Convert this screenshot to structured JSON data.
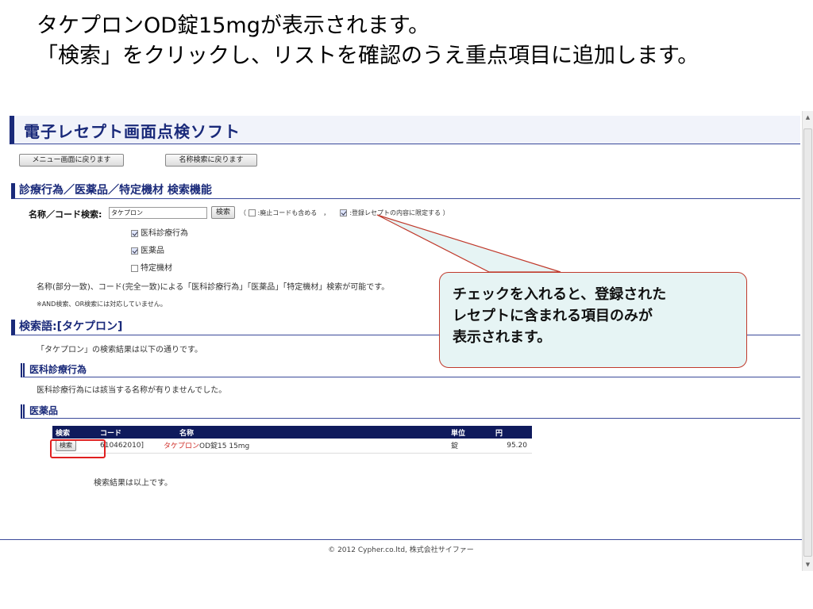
{
  "caption": {
    "line1": "タケプロンOD錠15mgが表示されます。",
    "line2": "「検索」をクリックし、リストを確認のうえ重点項目に追加します。"
  },
  "app": {
    "title": "電子レセプト画面点検ソフト",
    "buttons": {
      "back_menu": "メニュー画面に戻ります",
      "back_name_search": "名称検索に戻ります"
    }
  },
  "search_section": {
    "title": "診療行為／医薬品／特定機材 検索機能",
    "field_label": "名称／コード検索:",
    "field_value": "タケプロン",
    "search_button": "検索",
    "paren_open": "（",
    "option_abolished": ":廃止コードも含める　，",
    "option_abolished_checked": false,
    "option_registered": ":登録レセプトの内容に限定する ）",
    "option_registered_checked": true,
    "categories": [
      {
        "label": "医科診療行為",
        "checked": true
      },
      {
        "label": "医薬品",
        "checked": true
      },
      {
        "label": "特定機材",
        "checked": false
      }
    ],
    "note1": "名称(部分一致)、コード(完全一致)による「医科診療行為」「医薬品」「特定機材」検索が可能です。",
    "note2": "※AND検索、OR検索には対応していません。"
  },
  "results_section": {
    "title": "検索語:[タケプロン]",
    "summary": "「タケプロン」の検索結果は以下の通りです。",
    "medical": {
      "title": "医科診療行為",
      "message": "医科診療行為には該当する名称が有りませんでした。"
    },
    "drugs": {
      "title": "医薬品",
      "columns": {
        "search": "検索",
        "code": "コード",
        "name": "名称",
        "unit": "単位",
        "yen": "円"
      },
      "rows": [
        {
          "button": "検索",
          "code": "610462010]",
          "name_link": "タケプロン",
          "name_rest": "OD錠15 15mg",
          "unit": "錠",
          "yen": "95.20"
        }
      ],
      "end_text": "検索結果は以上です。"
    }
  },
  "footer": "© 2012 Cypher.co.ltd, 株式会社サイファー",
  "callout": {
    "line1": "チェックを入れると、登録された",
    "line2": "レセプトに含まれる項目のみが",
    "line3": "表示されます。"
  },
  "colors": {
    "brand_navy": "#1a2a7a",
    "table_header": "#0f1a5c",
    "highlight_red": "#e02020",
    "link_red": "#d0302a",
    "callout_fill": "#e6f4f4"
  },
  "icons": {
    "scroll_up": "scroll-up-arrow-icon",
    "scroll_down": "scroll-down-arrow-icon"
  }
}
